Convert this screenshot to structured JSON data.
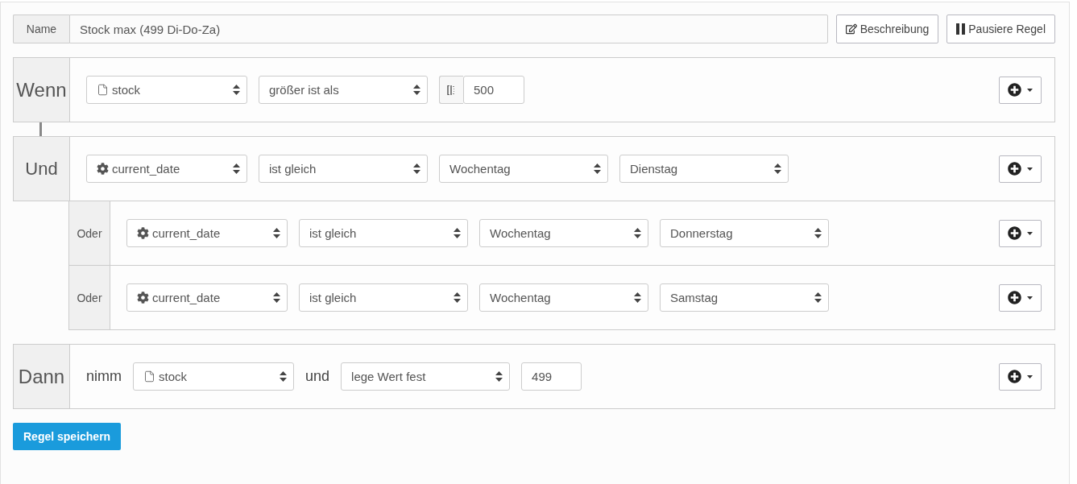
{
  "name_field": {
    "label": "Name",
    "value": "Stock max (499 Di-Do-Za)"
  },
  "buttons": [
    {
      "label": "Beschreibung",
      "kind": "edit"
    },
    {
      "label": "Pausiere Regel",
      "kind": "pause"
    }
  ],
  "blocks": [
    {
      "kind": "if",
      "label": "Wenn",
      "items": [
        {
          "kind": "attribute-select",
          "value": "stock"
        },
        {
          "kind": "select",
          "value": "größer ist als"
        },
        {
          "kind": "range-number",
          "value": "500"
        }
      ]
    },
    {
      "kind": "and",
      "label": "Und",
      "items": [
        {
          "kind": "system-select",
          "value": "current_date"
        },
        {
          "kind": "select",
          "value": "ist gleich"
        },
        {
          "kind": "select",
          "value": "Wochentag"
        },
        {
          "kind": "select",
          "value": "Dienstag"
        }
      ],
      "children": [
        {
          "label": "Oder",
          "items": [
            {
              "kind": "system-select",
              "value": "current_date"
            },
            {
              "kind": "select",
              "value": "ist gleich"
            },
            {
              "kind": "select",
              "value": "Wochentag"
            },
            {
              "kind": "select",
              "value": "Donnerstag"
            }
          ]
        },
        {
          "label": "Oder",
          "items": [
            {
              "kind": "system-select",
              "value": "current_date"
            },
            {
              "kind": "select",
              "value": "ist gleich"
            },
            {
              "kind": "select",
              "value": "Wochentag"
            },
            {
              "kind": "select",
              "value": "Samstag"
            }
          ]
        }
      ]
    },
    {
      "kind": "then",
      "label": "Dann",
      "items": [
        {
          "kind": "word",
          "value": "nimm"
        },
        {
          "kind": "attribute-select",
          "value": "stock"
        },
        {
          "kind": "word",
          "value": "und"
        },
        {
          "kind": "select",
          "value": "lege Wert fest"
        },
        {
          "kind": "number",
          "value": "499"
        }
      ]
    }
  ],
  "save_button": "Regel speichern"
}
